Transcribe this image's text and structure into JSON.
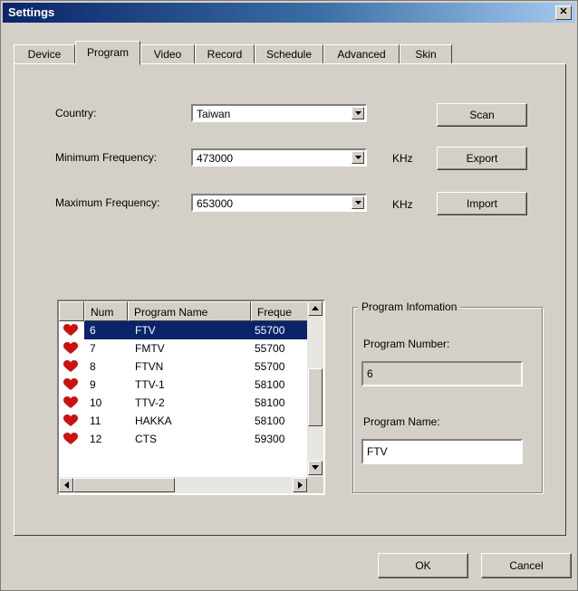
{
  "window": {
    "title": "Settings",
    "close_label": "✕"
  },
  "tabs": [
    "Device",
    "Program",
    "Video",
    "Record",
    "Schedule",
    "Advanced",
    "Skin"
  ],
  "active_tab": "Program",
  "form": {
    "country_label": "Country:",
    "country_value": "Taiwan",
    "min_freq_label": "Minimum Frequency:",
    "min_freq_value": "473000",
    "min_freq_unit": "KHz",
    "max_freq_label": "Maximum Frequency:",
    "max_freq_value": "653000",
    "max_freq_unit": "KHz"
  },
  "buttons": {
    "scan": "Scan",
    "export": "Export",
    "import": "Import",
    "ok": "OK",
    "cancel": "Cancel"
  },
  "program_list": {
    "columns": [
      "Num",
      "Program Name",
      "Freque"
    ],
    "rows": [
      {
        "num": "6",
        "name": "FTV",
        "freq": "55700",
        "selected": true
      },
      {
        "num": "7",
        "name": "FMTV",
        "freq": "55700",
        "selected": false
      },
      {
        "num": "8",
        "name": "FTVN",
        "freq": "55700",
        "selected": false
      },
      {
        "num": "9",
        "name": "TTV-1",
        "freq": "58100",
        "selected": false
      },
      {
        "num": "10",
        "name": "TTV-2",
        "freq": "58100",
        "selected": false
      },
      {
        "num": "11",
        "name": "HAKKA",
        "freq": "58100",
        "selected": false
      },
      {
        "num": "12",
        "name": "CTS",
        "freq": "59300",
        "selected": false
      }
    ],
    "row_icon": "heart-icon",
    "icon_color": "#cc1111",
    "selection_color": "#0a246a"
  },
  "program_info": {
    "title": "Program Infomation",
    "number_label": "Program Number:",
    "number_value": "6",
    "name_label": "Program Name:",
    "name_value": "FTV"
  }
}
